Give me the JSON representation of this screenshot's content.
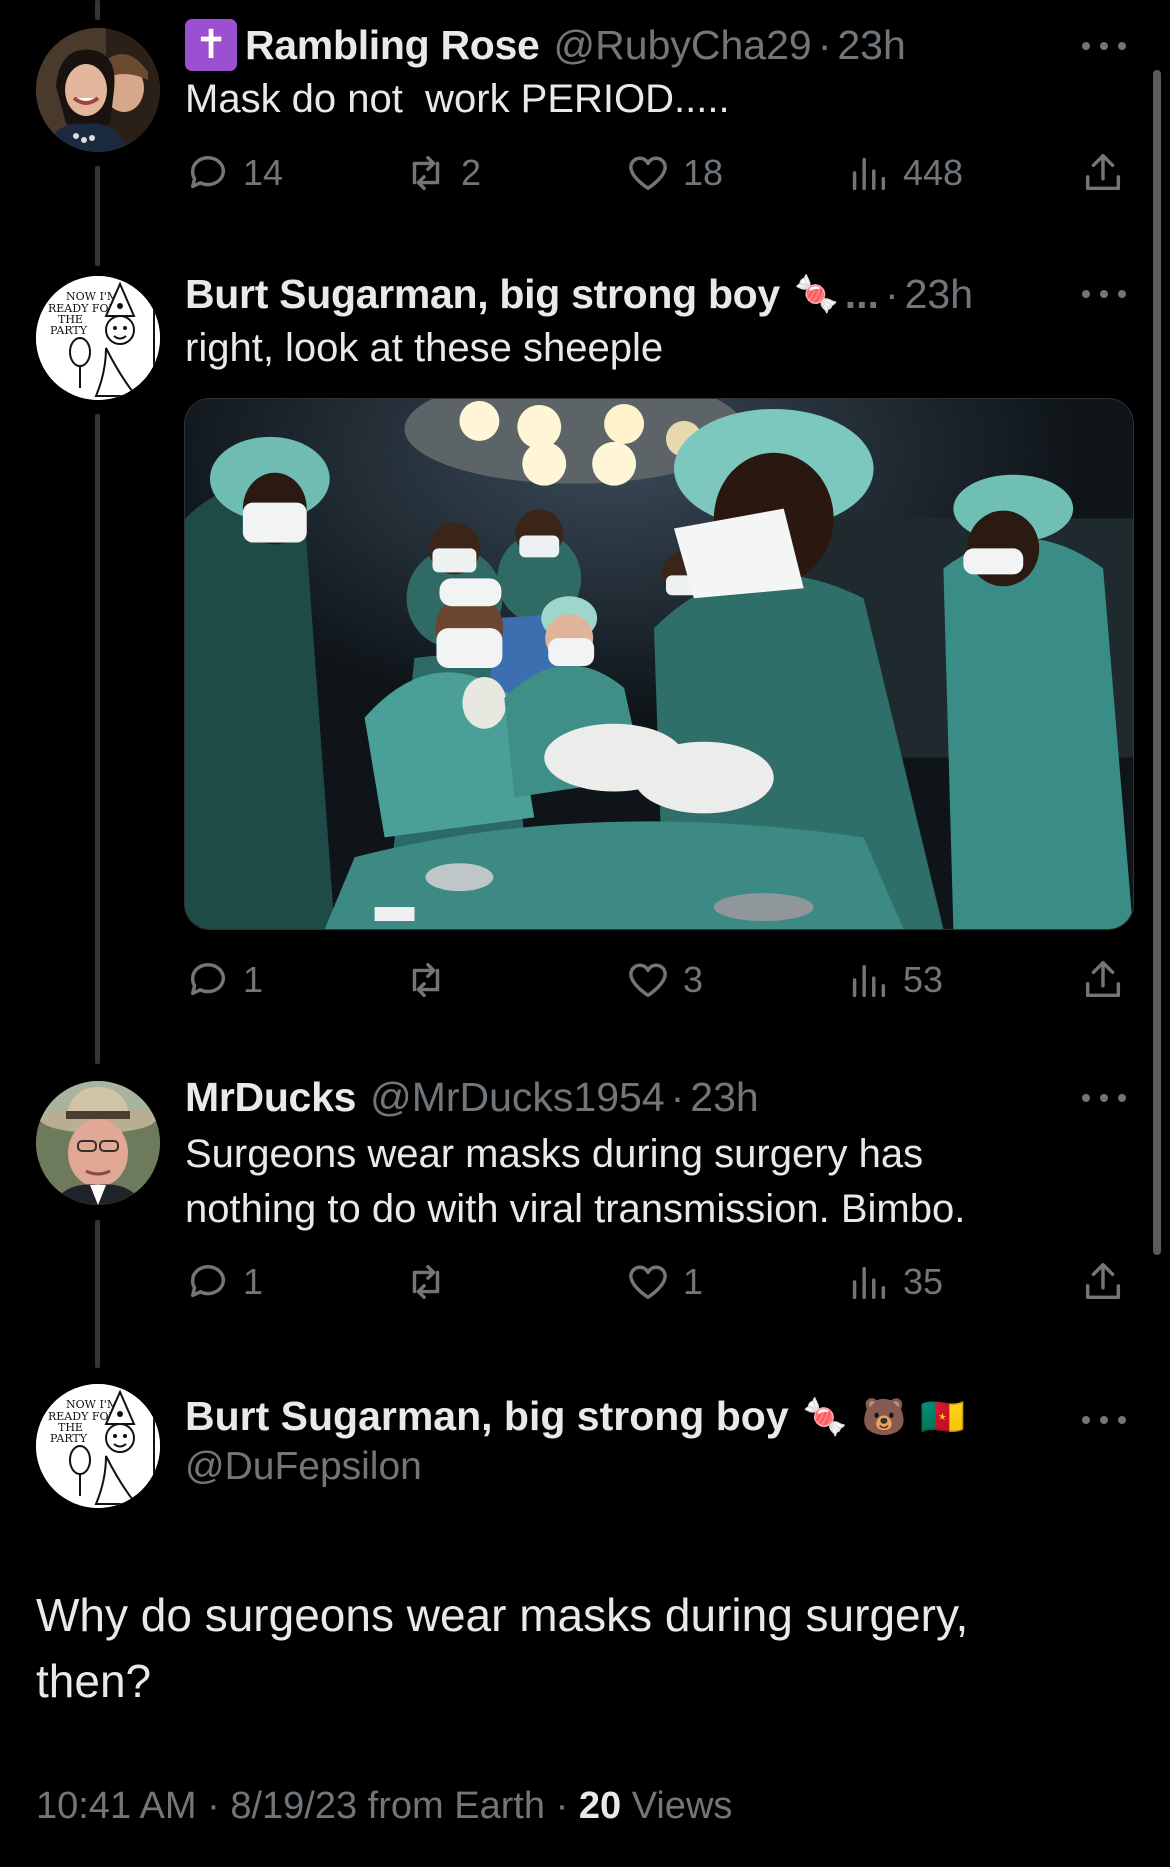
{
  "tweets": [
    {
      "name": "Rambling Rose",
      "handle": "@RubyCha29",
      "sep": "·",
      "time": "23h",
      "text": "Mask do not  work PERIOD.....",
      "badge_icon": "latin-cross",
      "stats": {
        "replies": "14",
        "reposts": "2",
        "likes": "18",
        "views": "448"
      }
    },
    {
      "name": "Burt Sugarman, big strong boy",
      "name_suffix": "...",
      "sep": "·",
      "time": "23h",
      "text": "right, look at these sheeple",
      "emoji": "🍬",
      "stats": {
        "replies": "1",
        "reposts": "",
        "likes": "3",
        "views": "53"
      }
    },
    {
      "name": "MrDucks",
      "handle": "@MrDucks1954",
      "sep": "·",
      "time": "23h",
      "text_line1": "Surgeons wear masks during surgery has",
      "text_line2": "nothing to do with viral transmission. Bimbo.",
      "stats": {
        "replies": "1",
        "reposts": "",
        "likes": "1",
        "views": "35"
      }
    }
  ],
  "main_tweet": {
    "name": "Burt Sugarman, big strong boy",
    "emojis": [
      "🍬",
      "🐻",
      "🇨🇲"
    ],
    "handle": "@DuFepsilon",
    "text_line1": "Why do surgeons wear masks during surgery,",
    "text_line2": "then?",
    "time": "10:41 AM",
    "sep": "·",
    "date": "8/19/23 from Earth",
    "views_count": "20",
    "views_label": "Views"
  },
  "avatar_text": {
    "line1": "NOW I'M",
    "line2": "READY FOR",
    "line3": "THE",
    "line4": "PARTY"
  },
  "colors": {
    "background": "#000000",
    "primary_text": "#e7e9ea",
    "secondary_text": "#71767b",
    "badge": "#9b4fd1",
    "thread_line": "#333639"
  }
}
